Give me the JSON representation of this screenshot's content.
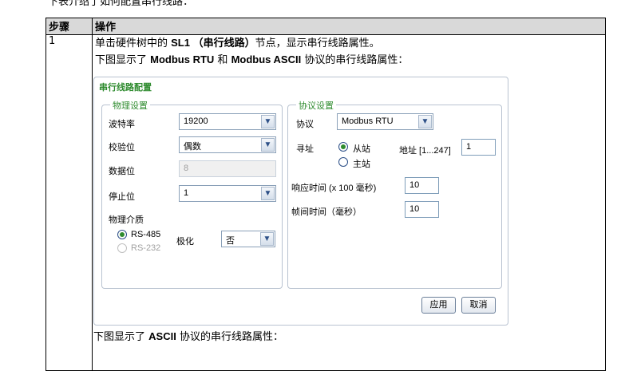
{
  "doc": {
    "top_fragment": "下表介绍了如何配置串行线路：",
    "header_step": "步骤",
    "header_action": "操作",
    "step_number": "1",
    "line1_pre": "单击硬件树中的 ",
    "line1_bold": "SL1 （串行线路）",
    "line1_post": "节点，显示串行线路属性。",
    "line2_pre": "下图显示了 ",
    "line2_bold1": "Modbus RTU",
    "line2_mid": " 和 ",
    "line2_bold2": "Modbus ASCII",
    "line2_post": " 协议的串行线路属性：",
    "bottom_pre": "下图显示了 ",
    "bottom_bold": "ASCII",
    "bottom_post": " 协议的串行线路属性："
  },
  "dialog": {
    "title": "串行线路配置",
    "physical": {
      "legend": "物理设置",
      "baud_label": "波特率",
      "baud_value": "19200",
      "parity_label": "校验位",
      "parity_value": "偶数",
      "databits_label": "数据位",
      "databits_value": "8",
      "stopbits_label": "停止位",
      "stopbits_value": "1",
      "medium_label": "物理介质",
      "rs485": "RS-485",
      "rs232": "RS-232",
      "polarization_label": "极化",
      "polarization_value": "否"
    },
    "protocol": {
      "legend": "协议设置",
      "protocol_label": "协议",
      "protocol_value": "Modbus RTU",
      "addressing_label": "寻址",
      "slave": "从站",
      "master": "主站",
      "address_label": "地址 [1...247]",
      "address_value": "1",
      "response_label": "响应时间 (x 100 毫秒)",
      "response_value": "10",
      "frame_label": "帧间时间（毫秒）",
      "frame_value": "10"
    },
    "apply": "应用",
    "cancel": "取消"
  }
}
